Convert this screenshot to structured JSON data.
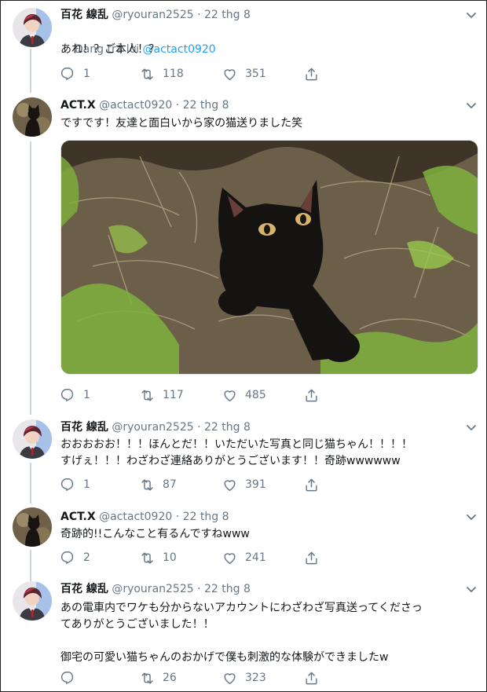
{
  "tweets": [
    {
      "name": "百花 線乱",
      "handle": "@ryouran2525",
      "time": "22 thg 8",
      "reply_prefix": "Đang trả lời ",
      "reply_mention": "@actact0920",
      "text": "あれ！？ご本人！？",
      "replies": "1",
      "retweets": "118",
      "likes": "351",
      "avatar": "avatar-ryouran"
    },
    {
      "name": "ACT.X",
      "handle": "@actact0920",
      "time": "22 thg 8",
      "text": "ですです！友達と面白いから家の猫送りました笑",
      "image": "black-kitten-in-bush",
      "replies": "1",
      "retweets": "117",
      "likes": "485",
      "avatar": "avatar-actx"
    },
    {
      "name": "百花 線乱",
      "handle": "@ryouran2525",
      "time": "22 thg 8",
      "text": "おおおおお！！！ほんとだ！！いただいた写真と同じ猫ちゃん！！！！\nすげぇ！！！わざわざ連絡ありがとうございます！！奇跡wwwwww",
      "replies": "1",
      "retweets": "87",
      "likes": "391",
      "avatar": "avatar-ryouran"
    },
    {
      "name": "ACT.X",
      "handle": "@actact0920",
      "time": "22 thg 8",
      "text": "奇跡的!!こんなこと有るんですねwww",
      "replies": "2",
      "retweets": "10",
      "likes": "241",
      "avatar": "avatar-actx"
    },
    {
      "name": "百花 線乱",
      "handle": "@ryouran2525",
      "time": "22 thg 8",
      "text": "あの電車内でワケも分からないアカウントにわざわざ写真送ってくださっ\nてありがとうございました！！\n\n御宅の可愛い猫ちゃんのおかげで僕も刺激的な体験ができましたw",
      "replies": "",
      "retweets": "26",
      "likes": "323",
      "avatar": "avatar-ryouran"
    }
  ],
  "colors": {
    "text": "#14171a",
    "muted": "#657786",
    "link": "#1da1f2",
    "line": "#ccd6dd"
  },
  "icons": [
    "reply-icon",
    "retweet-icon",
    "like-icon",
    "share-icon",
    "chevron-down-icon"
  ]
}
